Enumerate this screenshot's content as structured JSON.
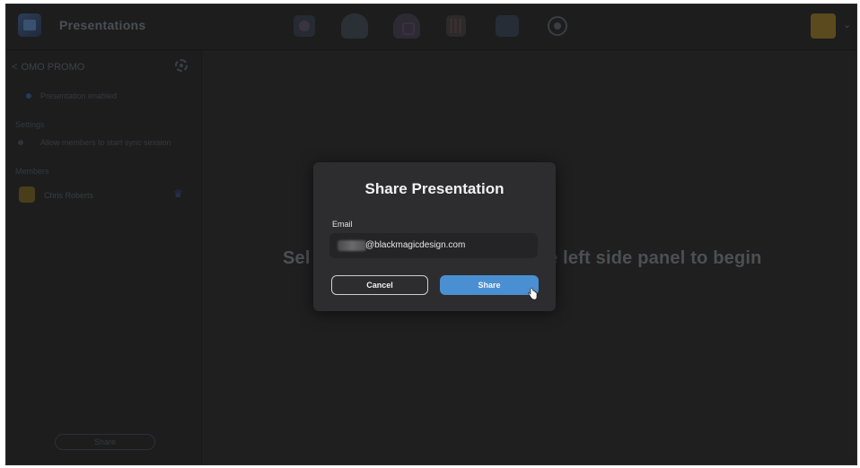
{
  "app": {
    "title": "Presentations"
  },
  "top_nav": {
    "icons": [
      "resolve-app-icon",
      "cloud-sync-icon",
      "cloud-media-icon",
      "color-grid-icon",
      "presentation-icon",
      "settings-circle-icon"
    ]
  },
  "sidebar": {
    "project_name": "OMO PROMO",
    "presentation_status": "Presentation enabled",
    "settings_heading": "Settings",
    "allow_sync_label": "Allow members to start sync session",
    "members_heading": "Members",
    "members": [
      {
        "name": "Chris Roberts"
      }
    ],
    "share_button": "Share"
  },
  "main": {
    "background_message_left": "Sel",
    "background_message_right": "e left side panel to begin"
  },
  "modal": {
    "title": "Share Presentation",
    "email_label": "Email",
    "email_value": "@blackmagicdesign.com",
    "cancel_label": "Cancel",
    "share_label": "Share"
  },
  "colors": {
    "share_button": "#4a8fd1",
    "modal_bg": "#2d2d2f",
    "window_bg": "#1f1f20"
  }
}
